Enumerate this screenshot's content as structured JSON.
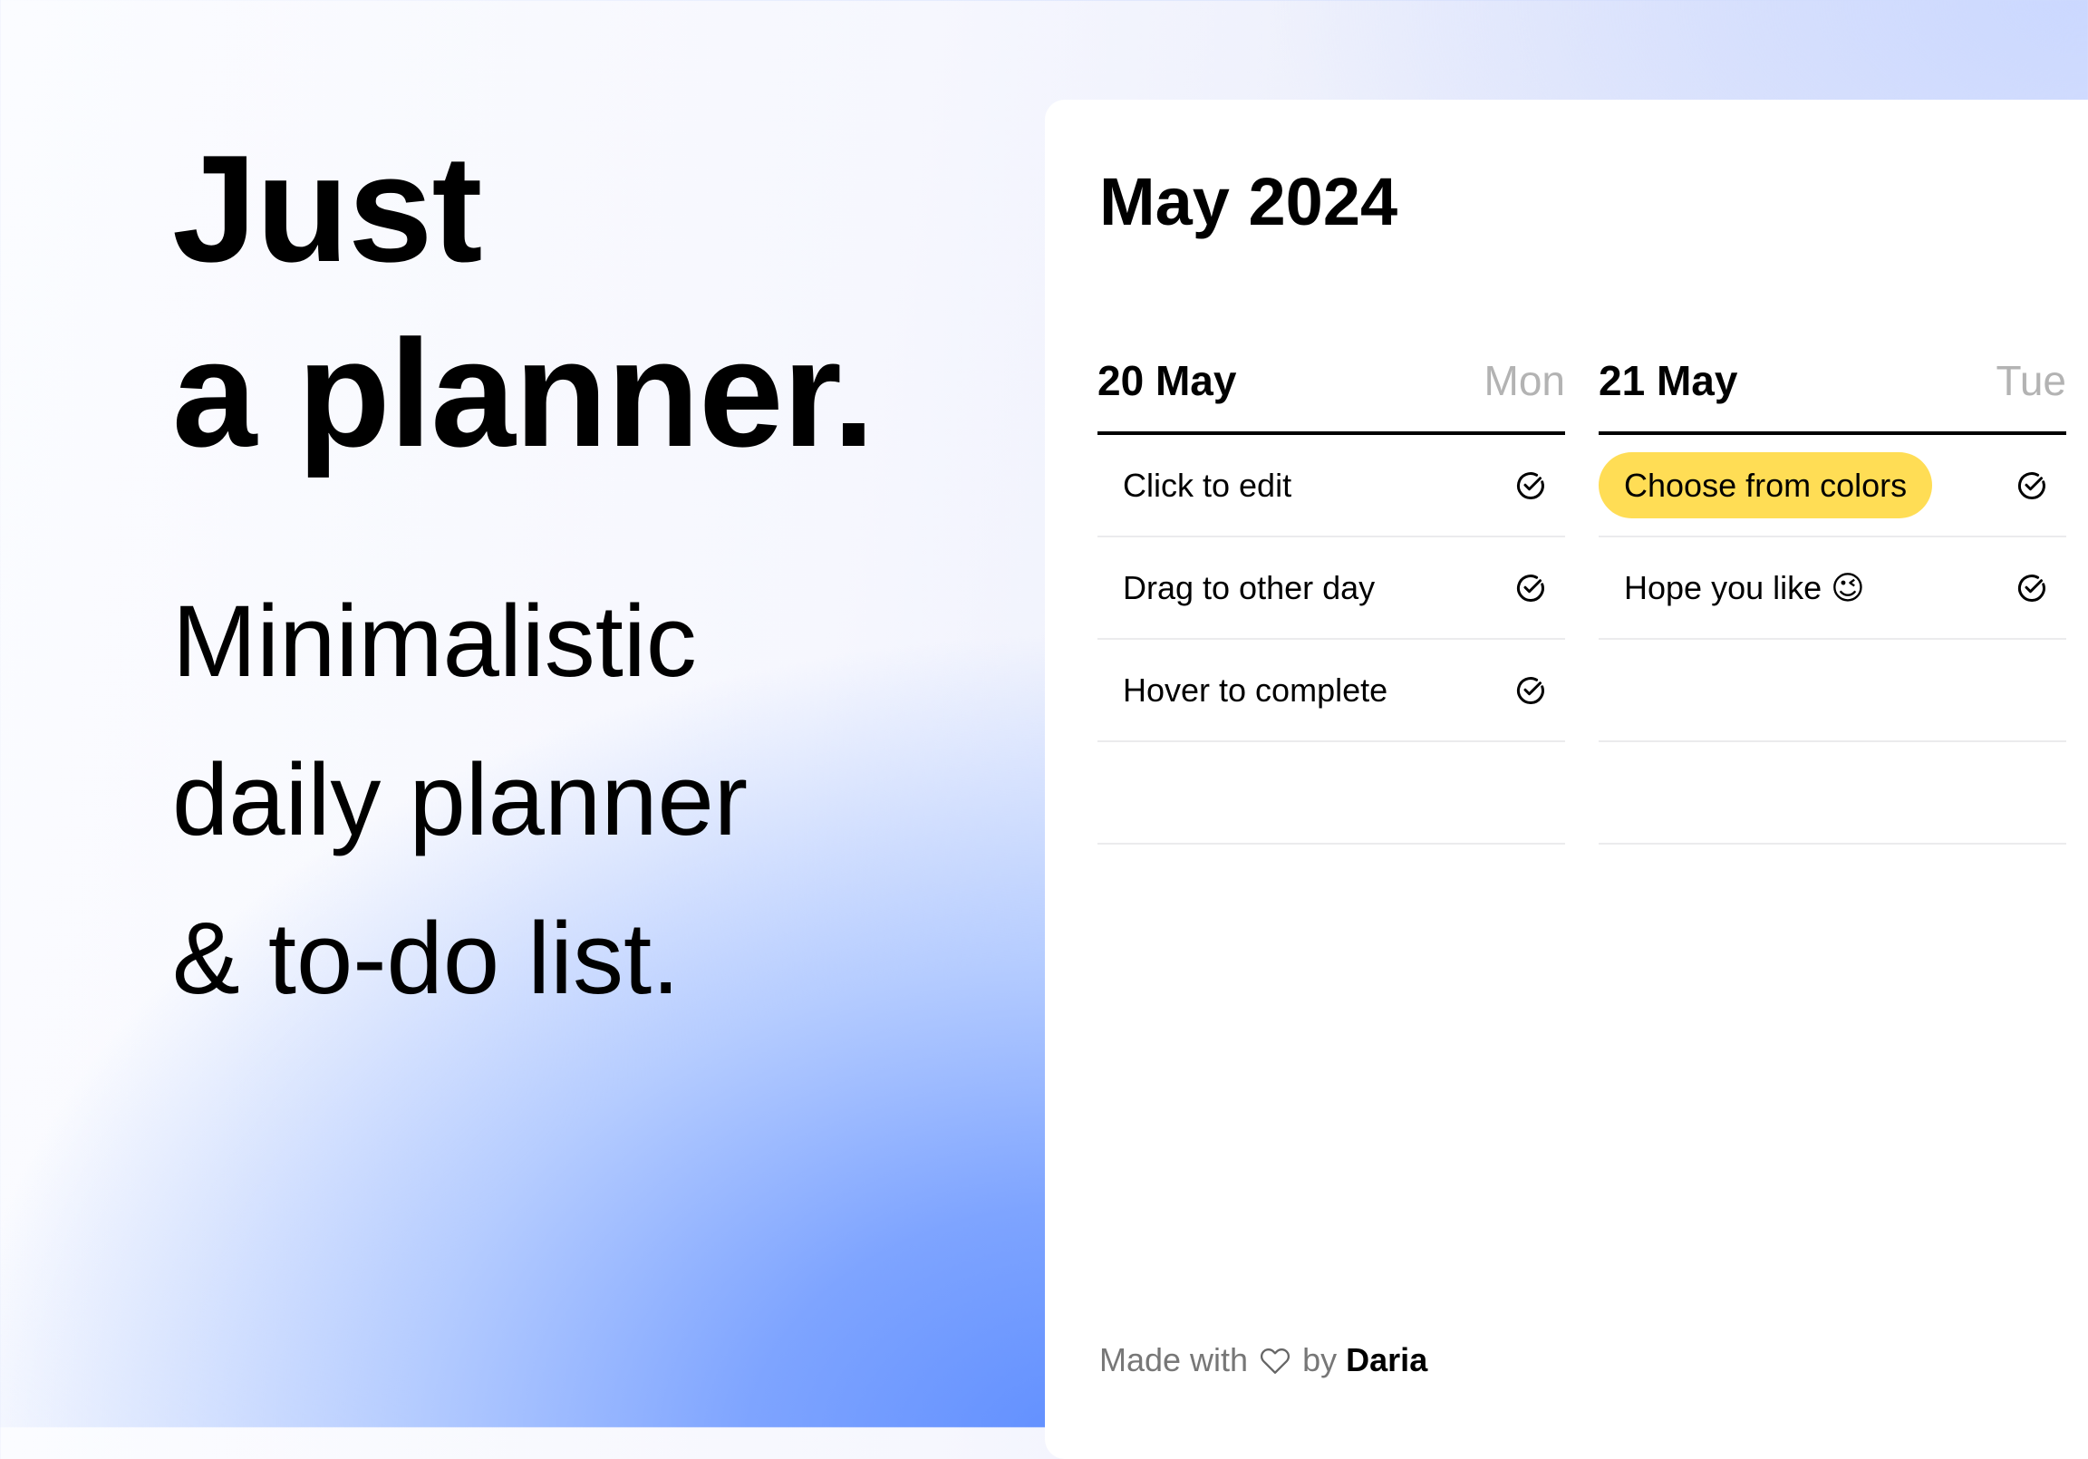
{
  "hero": {
    "title_lines": [
      "Just",
      "a planner."
    ],
    "subtitle_lines": [
      "Minimalistic",
      "daily planner",
      "& to-do list."
    ]
  },
  "planner": {
    "month_title": "May 2024",
    "days": [
      {
        "date": "20 May",
        "weekday": "Mon",
        "tasks": [
          {
            "text": "Click to edit",
            "icon": "check-circle-icon"
          },
          {
            "text": "Drag to other day",
            "icon": "check-circle-icon"
          },
          {
            "text": "Hover to complete",
            "icon": "check-circle-icon"
          },
          {
            "text": ""
          }
        ]
      },
      {
        "date": "21 May",
        "weekday": "Tue",
        "tasks": [
          {
            "text": "Choose from colors",
            "icon": "check-circle-icon",
            "highlight_color": "#FFDD55"
          },
          {
            "text": "Hope you like 😉",
            "icon": "check-circle-icon"
          },
          {
            "text": ""
          },
          {
            "text": ""
          }
        ]
      }
    ],
    "footer": {
      "prefix": "Made with",
      "icon": "heart-icon",
      "middle": "by",
      "author": "Daria"
    }
  },
  "colors": {
    "highlight_yellow": "#FFDD55",
    "background_blue": "#6494FF",
    "weekday_gray": "#B3B3B3"
  }
}
